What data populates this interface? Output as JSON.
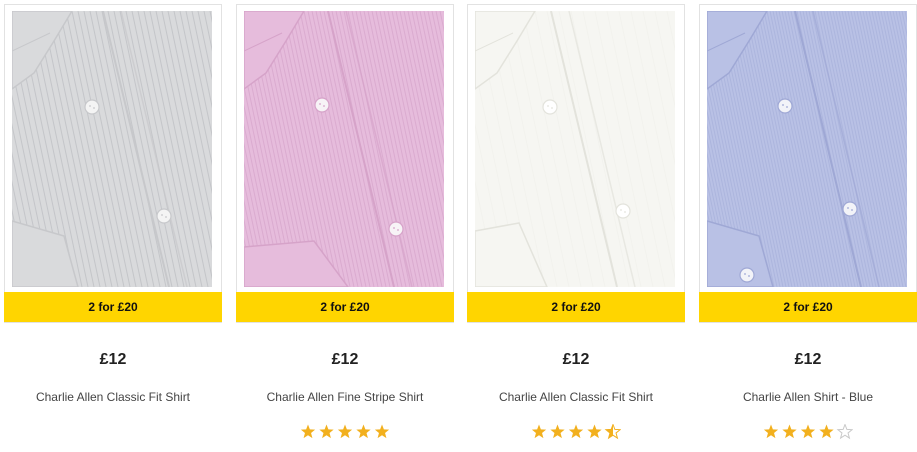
{
  "products": [
    {
      "promo": "2 for £20",
      "price": "£12",
      "name": "Charlie Allen Classic Fit Shirt",
      "colors": {
        "fabric": "#d9dadc",
        "stripe": "#bfc1c5",
        "shade": "#c7c8cb",
        "button": "#f4f4f4"
      },
      "pattern": "stripe",
      "rating": null
    },
    {
      "promo": "2 for £20",
      "price": "£12",
      "name": "Charlie Allen Fine Stripe Shirt",
      "colors": {
        "fabric": "#e6bcdc",
        "stripe": "#d8a7cd",
        "shade": "#d6a3c9",
        "button": "#f7f3f6"
      },
      "pattern": "fine-stripe",
      "rating": 5
    },
    {
      "promo": "2 for £20",
      "price": "£12",
      "name": "Charlie Allen Classic Fit Shirt",
      "colors": {
        "fabric": "#f6f6f2",
        "stripe": "#ececE6",
        "shade": "#e3e3dc",
        "button": "#ffffff"
      },
      "pattern": "plain",
      "rating": 4.5
    },
    {
      "promo": "2 for £20",
      "price": "£12",
      "name": "Charlie Allen Shirt - Blue",
      "colors": {
        "fabric": "#b9c1e5",
        "stripe": "#aab3dc",
        "shade": "#9fa8d5",
        "button": "#f2f3f8"
      },
      "pattern": "chambray",
      "rating": 4
    }
  ],
  "star_color": "#f2b01e",
  "star_empty_color": "#c9c9c9"
}
